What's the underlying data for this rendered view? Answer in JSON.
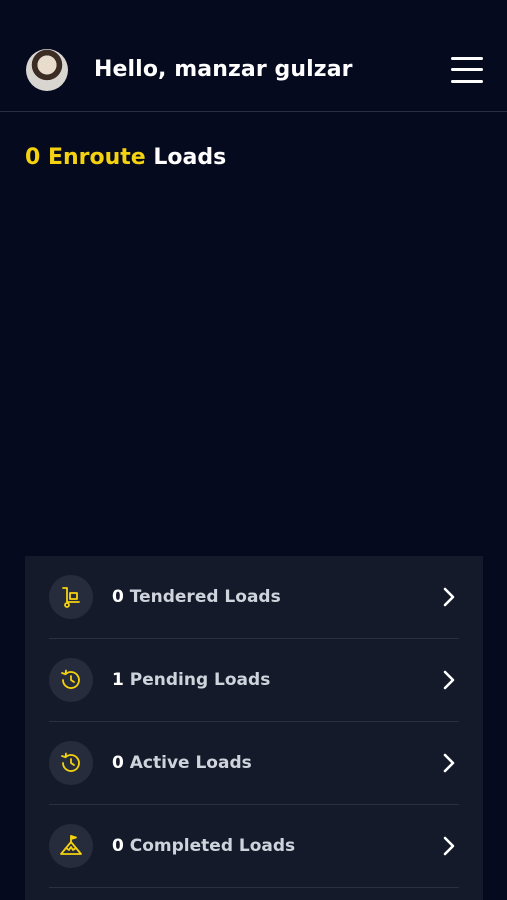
{
  "header": {
    "greeting": "Hello, manzar gulzar"
  },
  "enroute": {
    "count": "0 Enroute",
    "label": " Loads"
  },
  "loads": [
    {
      "count": "0",
      "label": " Tendered Loads",
      "icon": "cart-icon"
    },
    {
      "count": "1",
      "label": " Pending Loads",
      "icon": "clock-icon"
    },
    {
      "count": "0",
      "label": " Active Loads",
      "icon": "clock-icon"
    },
    {
      "count": "0",
      "label": " Completed Loads",
      "icon": "flag-icon"
    }
  ],
  "colors": {
    "background": "#050a1e",
    "panel": "#141a29",
    "accent": "#f5d20f"
  }
}
